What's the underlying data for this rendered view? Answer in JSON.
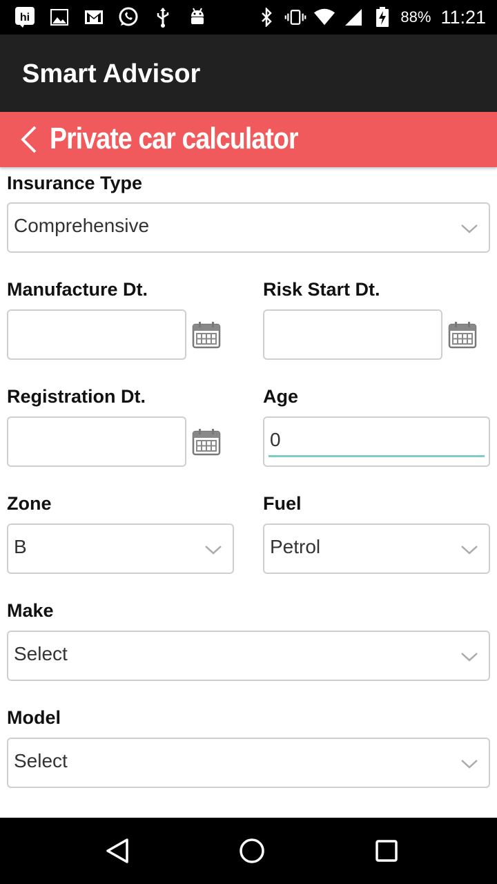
{
  "status_bar": {
    "battery_text": "88%",
    "time": "11:21",
    "left_icons": [
      "hi-app-icon",
      "image-icon",
      "gmail-icon",
      "whatsapp-icon",
      "usb-icon",
      "android-debug-icon"
    ],
    "right_icons": [
      "bluetooth-icon",
      "vibrate-icon",
      "wifi-icon",
      "signal-icon",
      "battery-charging-icon"
    ]
  },
  "app_bar": {
    "title": "Smart Advisor"
  },
  "sub_header": {
    "title": "Private car calculator",
    "color": "#f05a5c"
  },
  "form": {
    "insurance_type": {
      "label": "Insurance Type",
      "value": "Comprehensive"
    },
    "manufacture_dt": {
      "label": "Manufacture Dt.",
      "value": ""
    },
    "risk_start_dt": {
      "label": "Risk Start Dt.",
      "value": ""
    },
    "registration_dt": {
      "label": "Registration Dt.",
      "value": ""
    },
    "age": {
      "label": "Age",
      "value": "0"
    },
    "zone": {
      "label": "Zone",
      "value": "B"
    },
    "fuel": {
      "label": "Fuel",
      "value": "Petrol"
    },
    "make": {
      "label": "Make",
      "value": "Select"
    },
    "model": {
      "label": "Model",
      "value": "Select"
    },
    "focus_color": "#7ecdc4"
  }
}
